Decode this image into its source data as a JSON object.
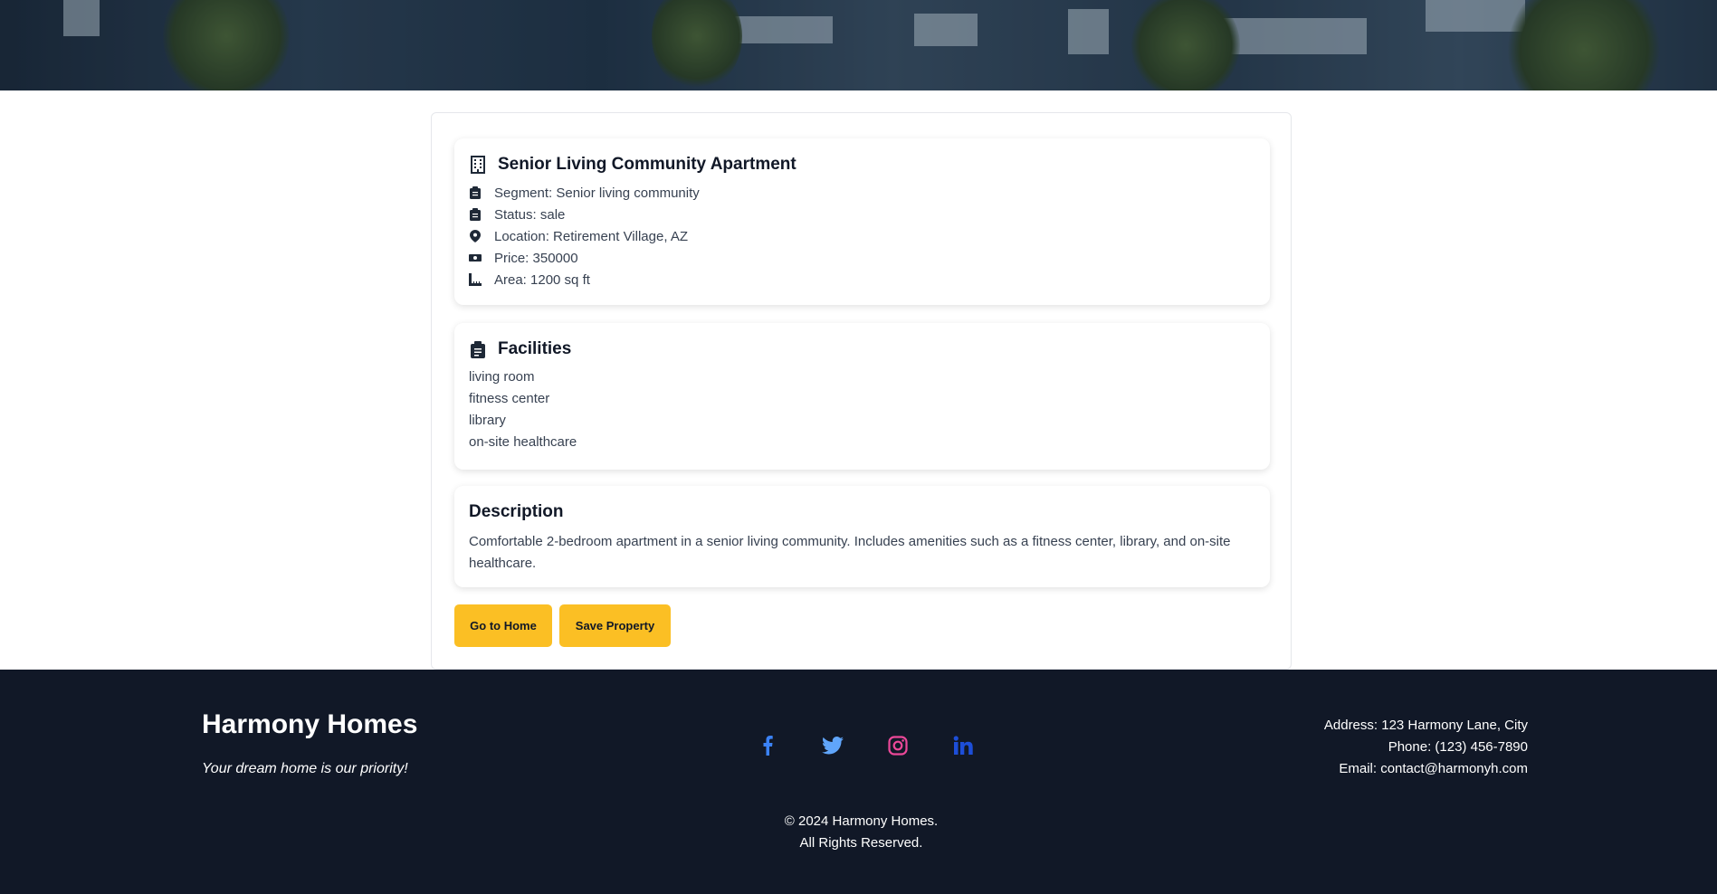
{
  "property": {
    "title": "Senior Living Community Apartment",
    "segment": "Segment: Senior living community",
    "status": "Status: sale",
    "location": "Location: Retirement Village, AZ",
    "price": "Price: 350000",
    "area": "Area: 1200 sq ft"
  },
  "facilities": {
    "title": "Facilities",
    "items": [
      "living room",
      "fitness center",
      "library",
      "on-site healthcare"
    ]
  },
  "description": {
    "title": "Description",
    "text": "Comfortable 2-bedroom apartment in a senior living community. Includes amenities such as a fitness center, library, and on-site healthcare."
  },
  "actions": {
    "home_label": "Go to Home",
    "save_label": "Save Property"
  },
  "footer": {
    "brand": "Harmony Homes",
    "tagline": "Your dream home is our priority!",
    "socials": [
      {
        "icon": "facebook-icon",
        "color": "#3b82f6"
      },
      {
        "icon": "twitter-icon",
        "color": "#60a5fa"
      },
      {
        "icon": "instagram-icon",
        "color": "#ec4899"
      },
      {
        "icon": "linkedin-icon",
        "color": "#1d4ed8"
      }
    ],
    "address": "Address: 123 Harmony Lane, City",
    "phone": "Phone: (123) 456-7890",
    "email": "Email: contact@harmonyh.com",
    "copyright_line1": "© 2024 Harmony Homes.",
    "copyright_line2": "All Rights Reserved."
  },
  "colors": {
    "accent": "#fbbf24",
    "footer_bg": "#111827"
  }
}
